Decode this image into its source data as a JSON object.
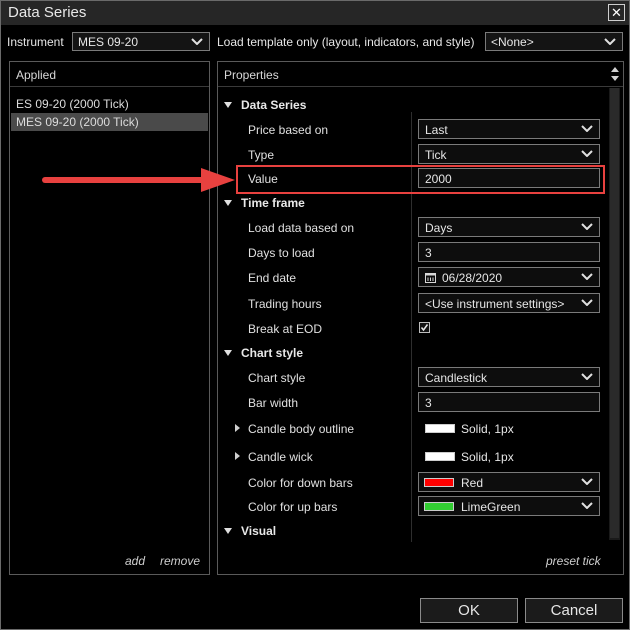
{
  "window": {
    "title": "Data Series",
    "close_glyph": "✕"
  },
  "toolbar": {
    "instrument_label": "Instrument",
    "instrument_value": "MES 09-20",
    "load_template_label": "Load template only (layout, indicators, and style)",
    "template_value": "<None>"
  },
  "applied": {
    "header": "Applied",
    "items": [
      {
        "label": "ES 09-20 (2000 Tick)",
        "selected": false
      },
      {
        "label": "MES 09-20 (2000 Tick)",
        "selected": true
      }
    ],
    "add_label": "add",
    "remove_label": "remove"
  },
  "properties": {
    "header": "Properties",
    "sections": {
      "data_series": "Data Series",
      "time_frame": "Time frame",
      "chart_style": "Chart style",
      "visual": "Visual"
    },
    "rows": {
      "price_based_on": {
        "label": "Price based on",
        "value": "Last"
      },
      "type": {
        "label": "Type",
        "value": "Tick"
      },
      "value": {
        "label": "Value",
        "value": "2000"
      },
      "load_data_based_on": {
        "label": "Load data based on",
        "value": "Days"
      },
      "days_to_load": {
        "label": "Days to load",
        "value": "3"
      },
      "end_date": {
        "label": "End date",
        "value": "06/28/2020"
      },
      "trading_hours": {
        "label": "Trading hours",
        "value": "<Use instrument settings>"
      },
      "break_at_eod": {
        "label": "Break at EOD",
        "checked": true
      },
      "chart_style": {
        "label": "Chart style",
        "value": "Candlestick"
      },
      "bar_width": {
        "label": "Bar width",
        "value": "3"
      },
      "candle_body_outline": {
        "label": "Candle body outline",
        "value": "Solid, 1px",
        "color": "#ffffff"
      },
      "candle_wick": {
        "label": "Candle wick",
        "value": "Solid, 1px",
        "color": "#ffffff"
      },
      "color_down_bars": {
        "label": "Color for down bars",
        "value": "Red",
        "color": "#ff0000"
      },
      "color_up_bars": {
        "label": "Color for up bars",
        "value": "LimeGreen",
        "color": "#32cd32"
      }
    },
    "preset_label": "preset tick"
  },
  "buttons": {
    "ok": "OK",
    "cancel": "Cancel"
  },
  "annotation": {
    "arrow_color": "#e8413f",
    "highlight_color": "#e8413f"
  }
}
